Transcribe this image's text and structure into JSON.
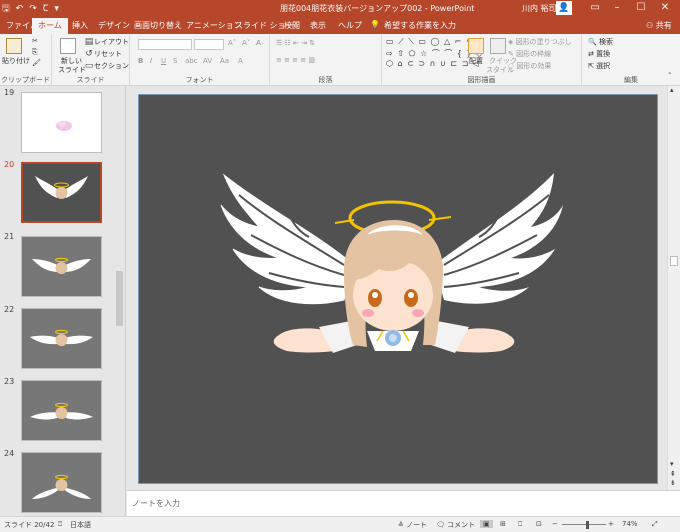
{
  "window": {
    "title": "朋花004朋花衣装バージョンアップ002 - PowerPoint",
    "user": "川内 裕司",
    "qat": {
      "save": "🖫",
      "undo": "↶",
      "redo": "↷",
      "touch": "Ꞇ"
    }
  },
  "tabs": [
    {
      "label": "ファイル",
      "active": false
    },
    {
      "label": "ホーム",
      "active": true
    },
    {
      "label": "挿入",
      "active": false
    },
    {
      "label": "デザイン",
      "active": false
    },
    {
      "label": "画面切り替え",
      "active": false
    },
    {
      "label": "アニメーション",
      "active": false
    },
    {
      "label": "スライド ショー",
      "active": false
    },
    {
      "label": "校閲",
      "active": false
    },
    {
      "label": "表示",
      "active": false
    },
    {
      "label": "ヘルプ",
      "active": false
    }
  ],
  "tellme": "希望する作業を入力",
  "share": "共有",
  "ribbon": {
    "clipboard": {
      "label": "クリップボード",
      "paste": "貼り付け"
    },
    "slides": {
      "label": "スライド",
      "new_slide_1": "新しい",
      "new_slide_2": "スライド",
      "layout": "レイアウト",
      "reset": "リセット",
      "section": "セクション"
    },
    "font": {
      "label": "フォント"
    },
    "paragraph": {
      "label": "段落"
    },
    "drawing": {
      "label": "図形描画",
      "arrange": "配置",
      "quick_style_1": "クイック",
      "quick_style_2": "スタイル",
      "fill": "図形の塗りつぶし",
      "outline": "図形の枠線",
      "effects": "図形の効果"
    },
    "editing": {
      "label": "編集",
      "find": "検索",
      "replace": "置換",
      "select": "選択"
    }
  },
  "thumbnails": [
    {
      "number": "19",
      "selected": false,
      "bg": "#ffffff"
    },
    {
      "number": "20",
      "selected": true,
      "bg": "#515151"
    },
    {
      "number": "21",
      "selected": false,
      "bg": "#777777"
    },
    {
      "number": "22",
      "selected": false,
      "bg": "#777777"
    },
    {
      "number": "23",
      "selected": false,
      "bg": "#777777"
    },
    {
      "number": "24",
      "selected": false,
      "bg": "#777777"
    }
  ],
  "notes_placeholder": "ノートを入力",
  "status": {
    "slide": "スライド 20/42",
    "language": "日本語",
    "notes": "ノート",
    "comments": "コメント",
    "zoom": "74%"
  },
  "colors": {
    "accent": "#b7472a",
    "slide_bg": "#515151",
    "halo": "#f5c400",
    "hair": "#e3c3a1",
    "skin": "#fde3cf"
  }
}
